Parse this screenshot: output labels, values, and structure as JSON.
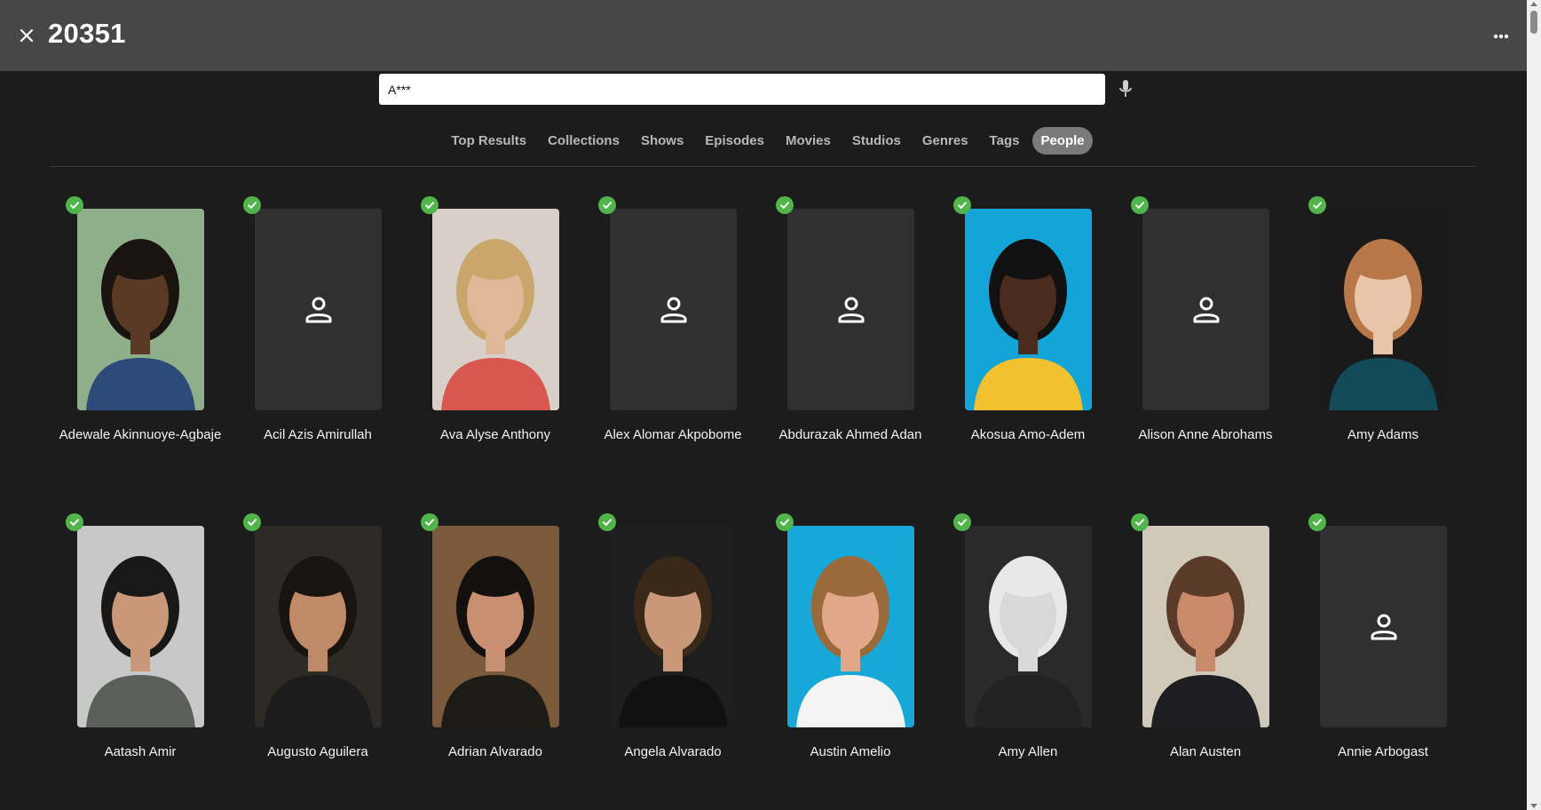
{
  "header": {
    "title": "20351",
    "close_icon": "close-icon",
    "more_icon": "more-icon"
  },
  "search": {
    "value": "A***",
    "mic_icon": "mic-icon"
  },
  "tabs": [
    {
      "label": "Top Results",
      "active": false
    },
    {
      "label": "Collections",
      "active": false
    },
    {
      "label": "Shows",
      "active": false
    },
    {
      "label": "Episodes",
      "active": false
    },
    {
      "label": "Movies",
      "active": false
    },
    {
      "label": "Studios",
      "active": false
    },
    {
      "label": "Genres",
      "active": false
    },
    {
      "label": "Tags",
      "active": false
    },
    {
      "label": "People",
      "active": true
    }
  ],
  "people": [
    {
      "name": "Adewale Akinnuoye-Agbaje",
      "has_image": true,
      "bg": "#8fae8a",
      "skin": "#5a3a25",
      "hair": "#1a1410",
      "shirt": "#2c4a7a",
      "played": true
    },
    {
      "name": "Acil Azis Amirullah",
      "has_image": false,
      "played": true
    },
    {
      "name": "Ava Alyse Anthony",
      "has_image": true,
      "bg": "#d8d0c8",
      "skin": "#e0b898",
      "hair": "#c9a66b",
      "shirt": "#d8584f",
      "played": true
    },
    {
      "name": "Alex Alomar Akpobome",
      "has_image": false,
      "played": true
    },
    {
      "name": "Abdurazak Ahmed Adan",
      "has_image": false,
      "played": true
    },
    {
      "name": "Akosua Amo-Adem",
      "has_image": true,
      "bg": "#13a5d8",
      "skin": "#4a2c1e",
      "hair": "#111111",
      "shirt": "#f2c12e",
      "played": true
    },
    {
      "name": "Alison Anne Abrohams",
      "has_image": false,
      "played": true
    },
    {
      "name": "Amy Adams",
      "has_image": true,
      "bg": "#1a1a1a",
      "skin": "#e8c4a8",
      "hair": "#b8784a",
      "shirt": "#124a5a",
      "played": true
    },
    {
      "name": "Aatash Amir",
      "has_image": true,
      "bg": "#c8c8c8",
      "skin": "#c89878",
      "hair": "#181818",
      "shirt": "#5a5f5a",
      "played": true
    },
    {
      "name": "Augusto Aguilera",
      "has_image": true,
      "bg": "#2e2a26",
      "skin": "#c08a68",
      "hair": "#1a1410",
      "shirt": "#1c1c1c",
      "played": true
    },
    {
      "name": "Adrian Alvarado",
      "has_image": true,
      "bg": "#7a5a3a",
      "skin": "#c89070",
      "hair": "#141010",
      "shirt": "#1e1a16",
      "played": true
    },
    {
      "name": "Angela Alvarado",
      "has_image": true,
      "bg": "#1e1e1e",
      "skin": "#c89878",
      "hair": "#3a2818",
      "shirt": "#111111",
      "played": true
    },
    {
      "name": "Austin Amelio",
      "has_image": true,
      "bg": "#18a8d8",
      "skin": "#e0a888",
      "hair": "#9a6a3a",
      "shirt": "#f4f4f4",
      "played": true
    },
    {
      "name": "Amy Allen",
      "has_image": true,
      "bg": "#2a2a2a",
      "skin": "#d8d8d8",
      "hair": "#e8e8e8",
      "shirt": "#222222",
      "played": true
    },
    {
      "name": "Alan Austen",
      "has_image": true,
      "bg": "#d0c8b8",
      "skin": "#c88a6a",
      "hair": "#5a3a28",
      "shirt": "#1e1e22",
      "played": true
    },
    {
      "name": "Annie Arbogast",
      "has_image": false,
      "played": true
    }
  ]
}
